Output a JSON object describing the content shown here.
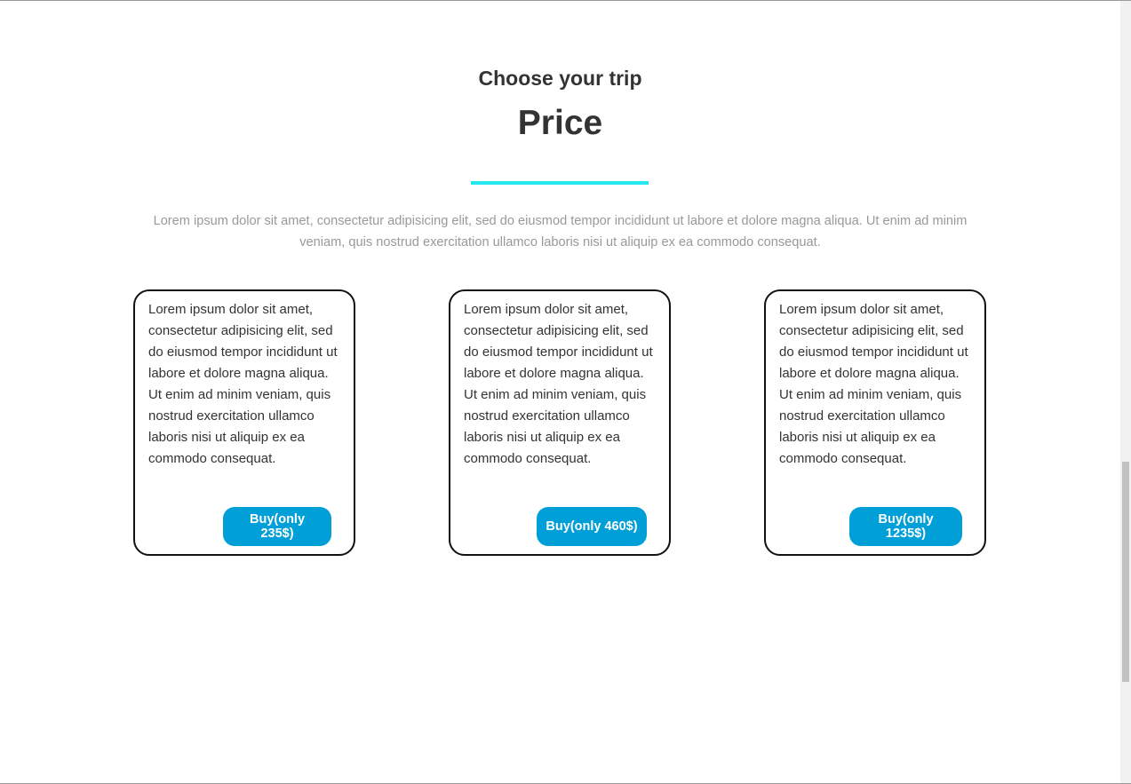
{
  "header": {
    "subtitle": "Choose your trip",
    "title": "Price",
    "intro": "Lorem ipsum dolor sit amet, consectetur adipisicing elit, sed do eiusmod tempor incididunt ut labore et dolore magna aliqua. Ut enim ad minim veniam, quis nostrud exercitation ullamco laboris nisi ut aliquip ex ea commodo consequat."
  },
  "cards": [
    {
      "text": "Lorem ipsum dolor sit amet, consectetur adipisicing elit, sed do eiusmod tempor incididunt ut labore et dolore magna aliqua. Ut enim ad minim veniam, quis nostrud exercitation ullamco laboris nisi ut aliquip ex ea commodo consequat.",
      "button": "Buy(only 235$)"
    },
    {
      "text": "Lorem ipsum dolor sit amet, consectetur adipisicing elit, sed do eiusmod tempor incididunt ut labore et dolore magna aliqua. Ut enim ad minim veniam, quis nostrud exercitation ullamco laboris nisi ut aliquip ex ea commodo consequat.",
      "button": "Buy(only 460$)"
    },
    {
      "text": "Lorem ipsum dolor sit amet, consectetur adipisicing elit, sed do eiusmod tempor incididunt ut labore et dolore magna aliqua. Ut enim ad minim veniam, quis nostrud exercitation ullamco laboris nisi ut aliquip ex ea commodo consequat.",
      "button": "Buy(only 1235$)"
    }
  ],
  "colors": {
    "accent_divider": "#26e8f0",
    "button_background": "#019fd7",
    "heading_text": "#333333",
    "intro_text": "#999999"
  }
}
